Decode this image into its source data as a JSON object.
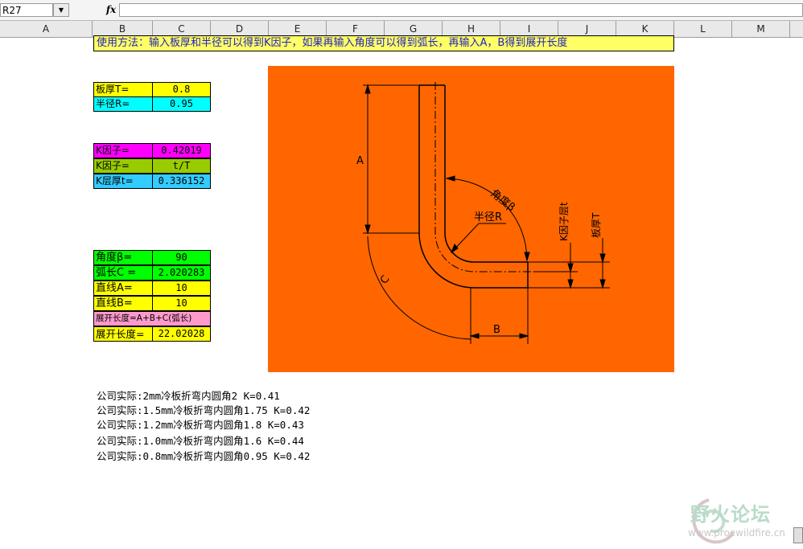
{
  "formula_bar": {
    "name_box": "R27",
    "fx_label": "fx",
    "formula": ""
  },
  "columns": [
    "A",
    "B",
    "C",
    "D",
    "E",
    "F",
    "G",
    "H",
    "I",
    "J",
    "K",
    "L",
    "M"
  ],
  "instructions": "使用方法：输入板厚和半径可以得到K因子，如果再输入角度可以得到弧长，再输入A，B得到展开长度",
  "inputs": {
    "thickness": {
      "label": "板厚T=",
      "value": "0.8",
      "label_color": "#ffff00",
      "value_color": "#ffff00"
    },
    "radius": {
      "label": "半径R=",
      "value": "0.95",
      "label_color": "#00ffff",
      "value_color": "#00ffff"
    }
  },
  "kfactor": {
    "k": {
      "label": "K因子=",
      "value": "0.42019",
      "color": "#ff00ff"
    },
    "formula": {
      "label": "K因子=",
      "value": "t/T",
      "color": "#99cc00"
    },
    "layer": {
      "label": "K层厚t=",
      "value": "0.336152",
      "color": "#33ccff"
    }
  },
  "lengths": {
    "angle": {
      "label": "角度β=",
      "value": "90",
      "color": "#00ff00"
    },
    "arc": {
      "label": "弧长C =",
      "value": "2.020283",
      "color": "#00ff00"
    },
    "line_a": {
      "label": "直线A=",
      "value": "10",
      "color": "#ffff00"
    },
    "line_b": {
      "label": "直线B=",
      "value": "10",
      "color": "#ffff00"
    },
    "formula_note": {
      "label": "展开长度=A+B+C(弧长)",
      "color": "#ff99cc"
    },
    "total": {
      "label": "展开长度=",
      "value": "22.02028",
      "color": "#ffff00"
    }
  },
  "diagram": {
    "background": "#ff6600",
    "label_a": "A",
    "label_b": "B",
    "label_c": "C",
    "label_angle": "角度β",
    "label_radius": "半径R",
    "label_k_layer": "K因子层t",
    "label_thickness": "板厚T"
  },
  "notes": [
    "公司实际:2mm冷板折弯内圆角2 K=0.41",
    "公司实际:1.5mm冷板折弯内圆角1.75 K=0.42",
    "公司实际:1.2mm冷板折弯内圆角1.8 K=0.43",
    "公司实际:1.0mm冷板折弯内圆角1.6 K=0.44",
    "公司实际:0.8mm冷板折弯内圆角0.95 K=0.42"
  ],
  "watermark": {
    "text": "野火论坛",
    "url": "www.proewildfire.cn"
  }
}
